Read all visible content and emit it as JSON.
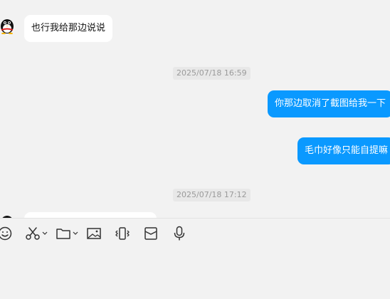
{
  "messages": [
    {
      "direction": "in",
      "text": "也行我给那边说说"
    },
    {
      "timestamp": "2025/07/18 16:59"
    },
    {
      "direction": "out",
      "text": "你那边取消了截图给我一下"
    },
    {
      "direction": "out",
      "text": "毛巾好像只能自提嘛"
    },
    {
      "timestamp": "2025/07/18 17:12"
    },
    {
      "direction": "in",
      "text": ""
    }
  ],
  "toolbar": {
    "icons": [
      "emoji-icon",
      "scissors-icon",
      "folder-icon",
      "image-icon",
      "vibrate-icon",
      "red-packet-icon",
      "microphone-icon"
    ]
  },
  "input": {
    "value": ""
  },
  "colors": {
    "outgoing_bubble": "#0a99ff",
    "incoming_bubble": "#ffffff",
    "background": "#f2f2f2"
  }
}
